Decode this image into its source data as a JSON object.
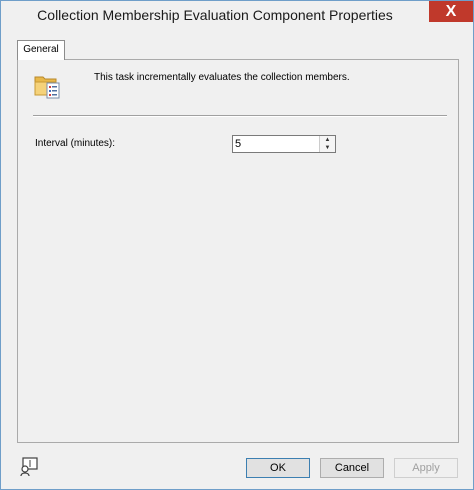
{
  "window": {
    "title": "Collection Membership Evaluation Component Properties",
    "close_glyph": "X"
  },
  "tabs": [
    {
      "label": "General"
    }
  ],
  "general": {
    "description": "This task incrementally evaluates the collection members.",
    "interval_label": "Interval (minutes):",
    "interval_value": "5"
  },
  "buttons": {
    "ok": "OK",
    "cancel": "Cancel",
    "apply": "Apply"
  },
  "icons": {
    "component": "folder-properties-icon",
    "help": "help-icon",
    "spin_up": "chevron-up-icon",
    "spin_down": "chevron-down-icon"
  },
  "colors": {
    "close_bg": "#c0392b",
    "window_border": "#6f9ec9",
    "dialog_bg": "#f0f0f0"
  }
}
